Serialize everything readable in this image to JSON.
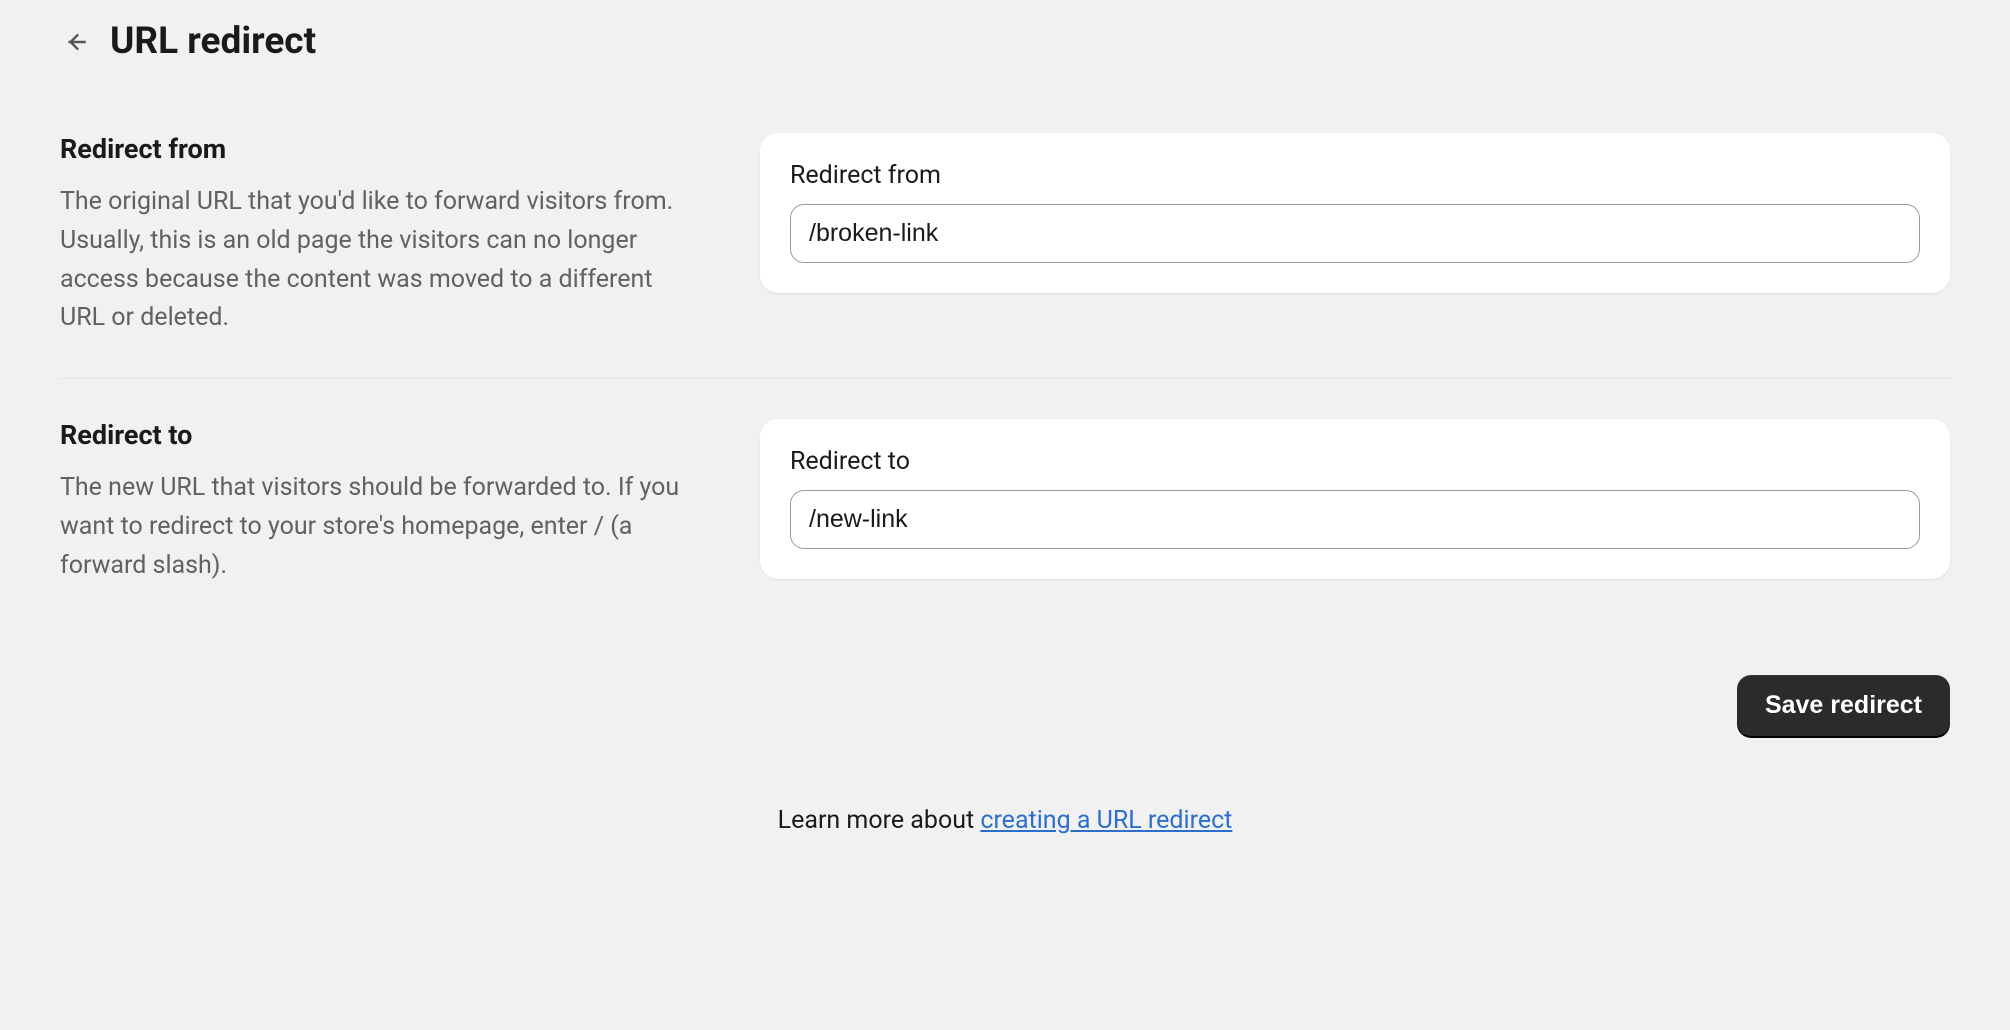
{
  "header": {
    "title": "URL redirect"
  },
  "sections": {
    "from": {
      "heading": "Redirect from",
      "description": "The original URL that you'd like to forward visitors from. Usually, this is an old page the visitors can no longer access because the content was moved to a different URL or deleted.",
      "input_label": "Redirect from",
      "input_value": "/broken-link"
    },
    "to": {
      "heading": "Redirect to",
      "description": "The new URL that visitors should be forwarded to. If you want to redirect to your store's homepage, enter / (a forward slash).",
      "input_label": "Redirect to",
      "input_value": "/new-link"
    }
  },
  "actions": {
    "save_label": "Save redirect"
  },
  "footer": {
    "prefix": "Learn more about ",
    "link_text": "creating a URL redirect"
  }
}
